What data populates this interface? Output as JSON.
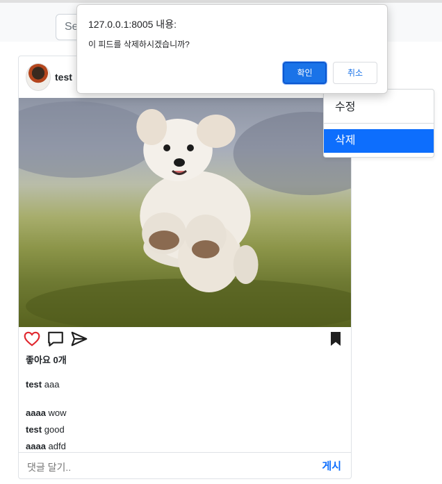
{
  "navbar": {
    "search_value": "Se"
  },
  "post": {
    "author": "test",
    "likes_text": "좋아요 0개",
    "caption": {
      "user": "test",
      "text": "aaa"
    },
    "comments": [
      {
        "user": "aaaa",
        "text": "wow"
      },
      {
        "user": "test",
        "text": "good"
      },
      {
        "user": "aaaa",
        "text": "adfd"
      }
    ],
    "comment_placeholder": "댓글 달기..",
    "post_button": "게시",
    "icons": [
      "heart-icon",
      "comment-icon",
      "send-icon",
      "bookmark-icon"
    ],
    "colors": {
      "like": "#e0262d",
      "link": "#0d6efd"
    }
  },
  "dropdown": {
    "edit_label": "수정",
    "delete_label": "삭제",
    "active_color": "#0d6efd"
  },
  "dialog": {
    "title": "127.0.0.1:8005 내용:",
    "message": "이 피드를 삭제하시겠습니까?",
    "ok_label": "확인",
    "cancel_label": "취소",
    "ok_color": "#1a73e8"
  }
}
